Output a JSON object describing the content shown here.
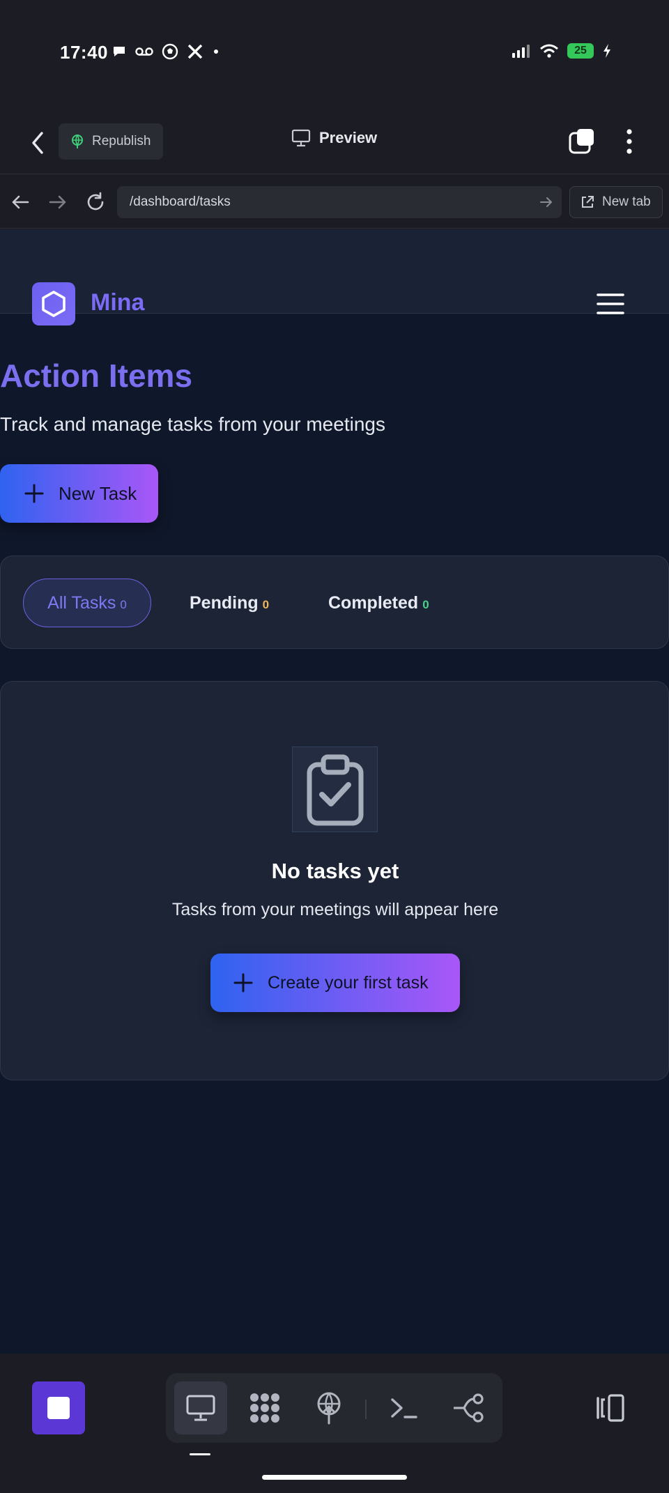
{
  "status_bar": {
    "time": "17:40",
    "battery": "25",
    "left_icons": [
      "chat-bubble-icon",
      "voicemail-icon",
      "soccer-ball-icon",
      "x-logo-icon",
      "dot-icon"
    ],
    "right_icons": [
      "signal-icon",
      "wifi-icon",
      "battery-icon",
      "charging-icon"
    ]
  },
  "header": {
    "republish_label": "Republish",
    "preview_label": "Preview"
  },
  "browser": {
    "url": "/dashboard/tasks",
    "new_tab_label": "New tab"
  },
  "site": {
    "brand": "Mina",
    "page_title": "Action Items",
    "page_subtitle": "Track and manage tasks from your meetings",
    "new_task_label": "New Task",
    "filters": [
      {
        "label": "All Tasks",
        "count": "0",
        "active": true
      },
      {
        "label": "Pending",
        "count": "0",
        "active": false
      },
      {
        "label": "Completed",
        "count": "0",
        "active": false
      }
    ],
    "empty_state": {
      "title": "No tasks yet",
      "subtitle": "Tasks from your meetings will appear here",
      "cta_label": "Create your first task"
    }
  },
  "colors": {
    "accent_purple": "#7b6ff0",
    "gradient_start": "#2f63f0",
    "gradient_end": "#a957f7",
    "stop_button": "#5b38d6"
  }
}
